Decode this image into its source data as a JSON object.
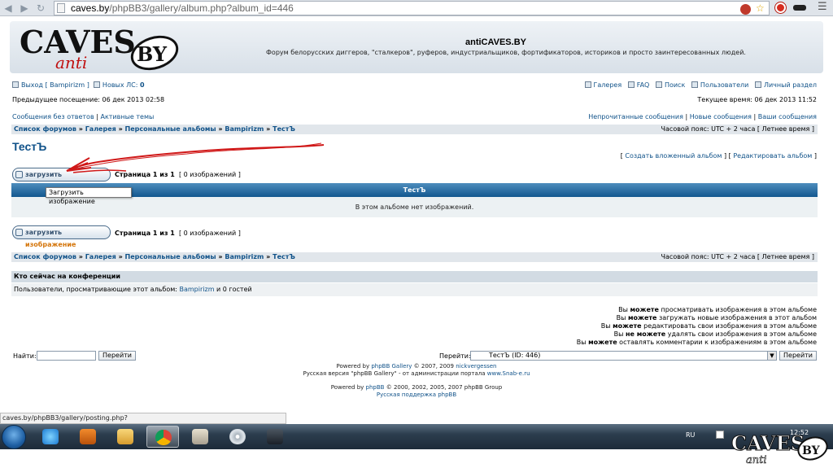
{
  "browser": {
    "url_host": "caves.by",
    "url_path": "/phpBB3/gallery/album.php?album_id=446"
  },
  "header": {
    "logo_text": "CAVES",
    "logo_sub": "anti",
    "logo_badge": "BY",
    "site_title": "antiCAVES.BY",
    "site_description": "Форум белорусских диггеров, \"сталкеров\", руферов, индустриальщиков, фортификаторов, историков и просто заинтересованных людей."
  },
  "userbar": {
    "logout": "Выход [ Bampirizm ]",
    "pm_label": "Новых ЛС:",
    "pm_count": "0",
    "gallery": "Галерея",
    "faq": "FAQ",
    "search": "Поиск",
    "members": "Пользователи",
    "ucp": "Личный раздел",
    "last_visit": "Предыдущее посещение: 06 дек 2013 02:58",
    "current_time": "Текущее время: 06 дек 2013 11:52"
  },
  "quicklinks": {
    "unanswered": "Сообщения без ответов",
    "active": "Активные темы",
    "unread": "Непрочитанные сообщения",
    "new_posts": "Новые сообщения",
    "your_posts": "Ваши сообщения",
    "sep": "|"
  },
  "breadcrumbs": {
    "items": [
      "Список форумов",
      "Галерея",
      "Персональные альбомы",
      "Bampirizm",
      "ТестЪ"
    ],
    "sep": "»",
    "timezone": "Часовой пояс: UTC + 2 часа [ Летнее время ]"
  },
  "album": {
    "title": "ТестЪ",
    "create_subalbum": "Создать вложенный альбом",
    "edit_album": "Редактировать альбом",
    "upload_prefix": "загрузить ",
    "upload_highlight": "изображение",
    "page_info": "Страница 1 из 1",
    "count": "[ 0 изображений ]",
    "table_title": "ТестЪ",
    "empty_message": "В этом альбоме нет изображений.",
    "tooltip": "Загрузить изображение"
  },
  "online": {
    "heading": "Кто сейчас на конференции",
    "text_prefix": "Пользователи, просматривающие этот альбом:",
    "user": "Bampirizm",
    "text_suffix": "и 0 гостей"
  },
  "permissions": [
    {
      "pre": "Вы",
      "em": "можете",
      "post": "просматривать изображения в этом альбоме"
    },
    {
      "pre": "Вы",
      "em": "можете",
      "post": "загружать новые изображения в этот альбом"
    },
    {
      "pre": "Вы",
      "em": "можете",
      "post": "редактировать свои изображения в этом альбоме"
    },
    {
      "pre": "Вы",
      "em": "не можете",
      "post": "удалять свои изображения в этом альбоме"
    },
    {
      "pre": "Вы",
      "em": "можете",
      "post": "оставлять комментарии к изображениям в этом альбоме"
    }
  ],
  "controls": {
    "find_label": "Найти:",
    "go_button": "Перейти",
    "jump_label": "Перейти:",
    "jump_value": "ТестЪ (ID: 446)",
    "jump_button": "Перейти"
  },
  "footer": {
    "line1_pre": "Powered by",
    "line1_link": "phpBB Gallery",
    "line1_mid": "© 2007, 2009",
    "line1_author": "nickvergessen",
    "line2_pre": "Русская версия \"phpBB Gallery\" - от администрации портала",
    "line2_link": "www.Snab-e.ru",
    "line3_pre": "Powered by",
    "line3_link": "phpBB",
    "line3_post": "© 2000, 2002, 2005, 2007 phpBB Group",
    "line4_link": "Русская поддержка phpBB"
  },
  "status_url": "caves.by/phpBB3/gallery/posting.php?mode=image&submode=upload&album_id=446",
  "taskbar": {
    "lang": "RU",
    "time": "12:52"
  },
  "colors": {
    "link": "#105289",
    "annotation_arrow": "#d01818",
    "table_header": "#12578f"
  }
}
